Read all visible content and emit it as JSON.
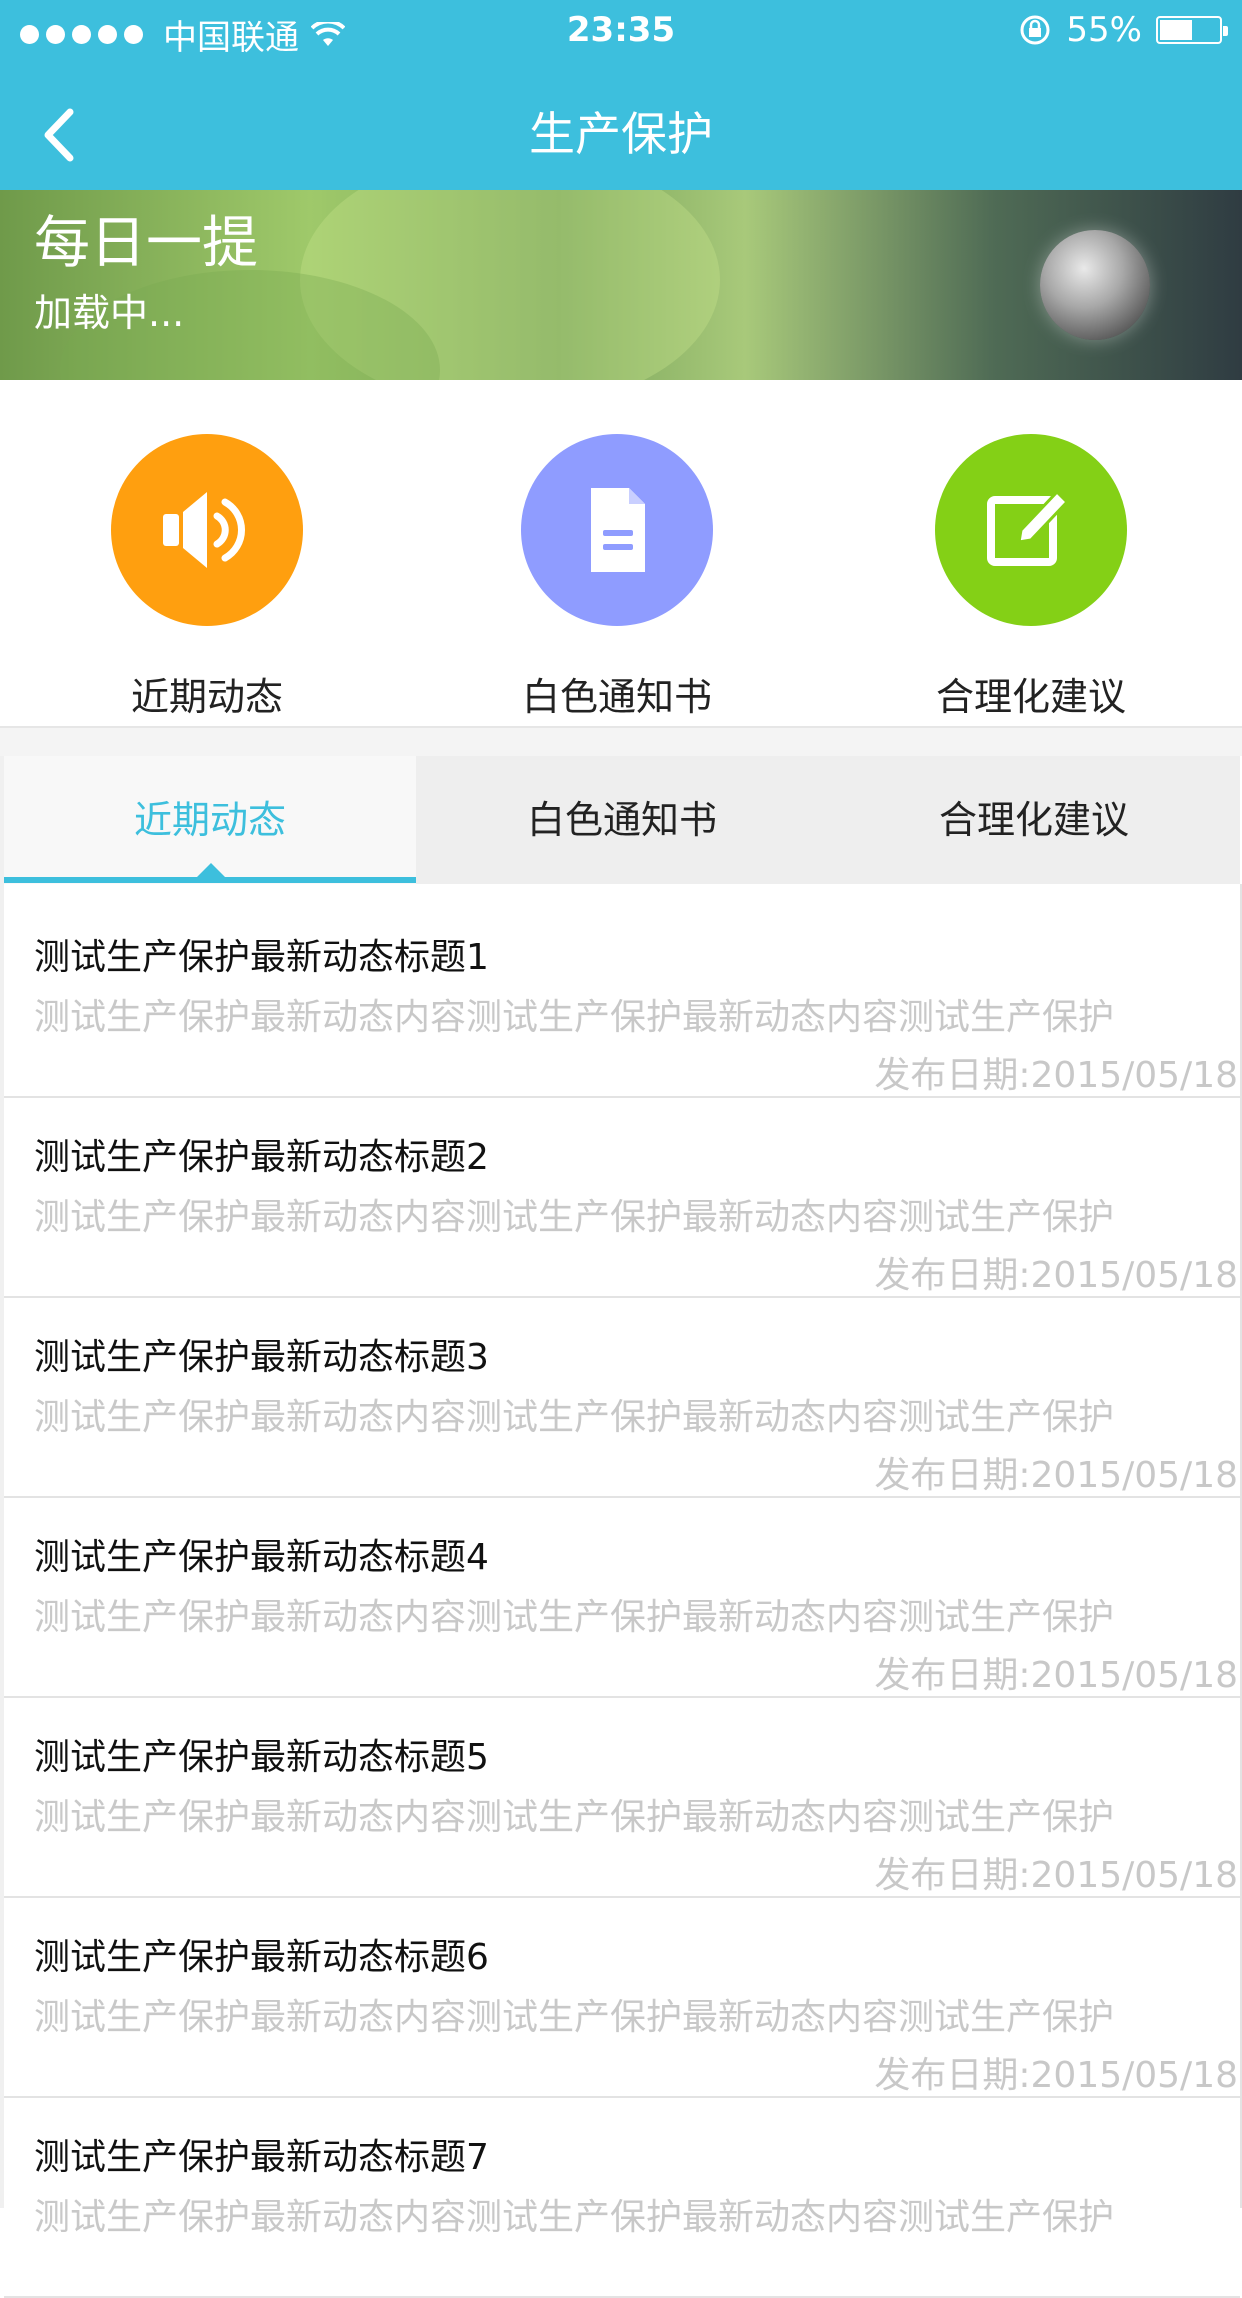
{
  "status_bar": {
    "carrier": "中国联通",
    "time": "23:35",
    "battery": "55%",
    "battery_level": 0.55
  },
  "nav": {
    "title": "生产保护"
  },
  "banner": {
    "title": "每日一提",
    "subtitle": "加载中..."
  },
  "shortcuts": [
    {
      "label": "近期动态",
      "icon": "speaker-icon",
      "color": "#ff9f0f"
    },
    {
      "label": "白色通知书",
      "icon": "document-icon",
      "color": "#8f9cff"
    },
    {
      "label": "合理化建议",
      "icon": "edit-icon",
      "color": "#84d016"
    }
  ],
  "tabs": [
    {
      "label": "近期动态",
      "active": true
    },
    {
      "label": "白色通知书",
      "active": false
    },
    {
      "label": "合理化建议",
      "active": false
    }
  ],
  "accent_color": "#3dbfdd",
  "news": [
    {
      "title": "测试生产保护最新动态标题1",
      "content": "测试生产保护最新动态内容测试生产保护最新动态内容测试生产保护",
      "date": "发布日期:2015/05/18"
    },
    {
      "title": "测试生产保护最新动态标题2",
      "content": "测试生产保护最新动态内容测试生产保护最新动态内容测试生产保护",
      "date": "发布日期:2015/05/18"
    },
    {
      "title": "测试生产保护最新动态标题3",
      "content": "测试生产保护最新动态内容测试生产保护最新动态内容测试生产保护",
      "date": "发布日期:2015/05/18"
    },
    {
      "title": "测试生产保护最新动态标题4",
      "content": "测试生产保护最新动态内容测试生产保护最新动态内容测试生产保护",
      "date": "发布日期:2015/05/18"
    },
    {
      "title": "测试生产保护最新动态标题5",
      "content": "测试生产保护最新动态内容测试生产保护最新动态内容测试生产保护",
      "date": "发布日期:2015/05/18"
    },
    {
      "title": "测试生产保护最新动态标题6",
      "content": "测试生产保护最新动态内容测试生产保护最新动态内容测试生产保护",
      "date": "发布日期:2015/05/18"
    },
    {
      "title": "测试生产保护最新动态标题7",
      "content": "测试生产保护最新动态内容测试生产保护最新动态内容测试生产保护",
      "date": ""
    }
  ]
}
